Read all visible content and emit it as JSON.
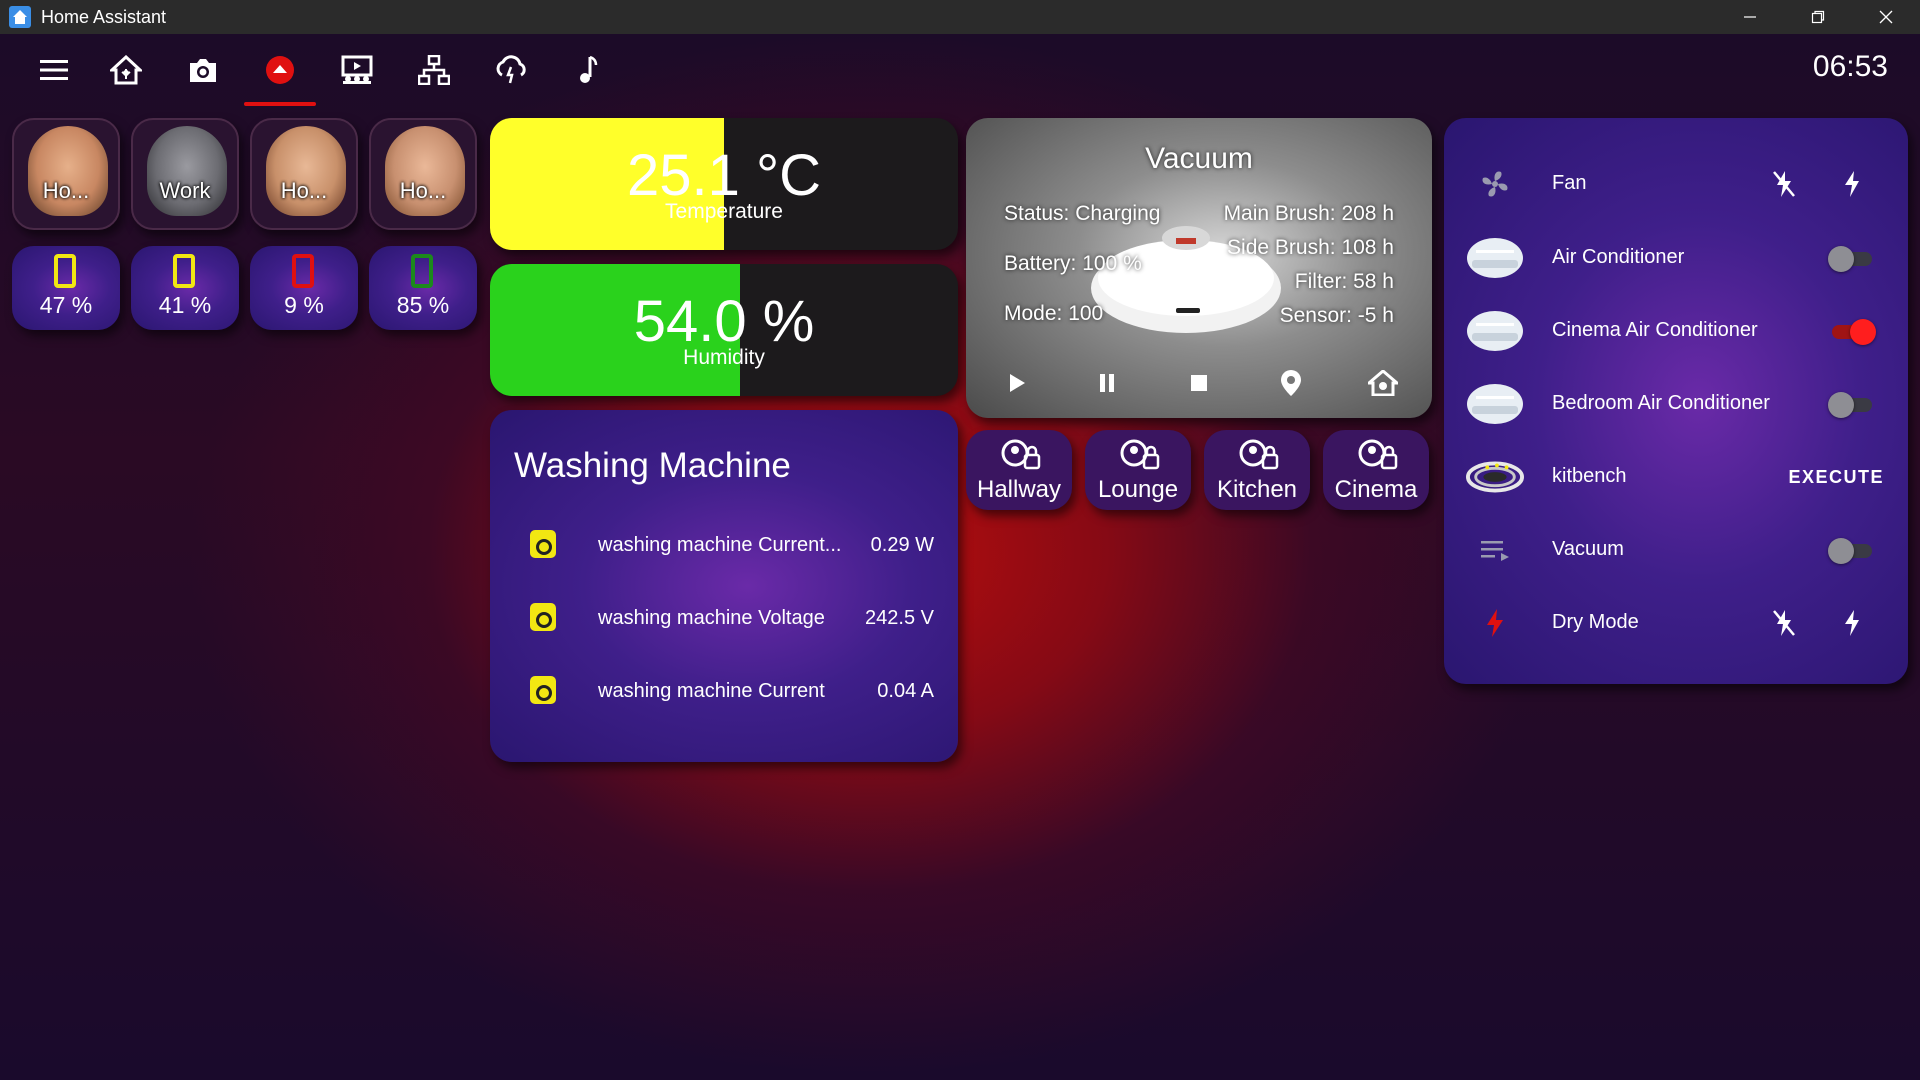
{
  "window": {
    "title": "Home Assistant"
  },
  "toolbar": {
    "clock": "06:53",
    "icons": [
      "menu-icon",
      "home-icon",
      "camera-icon",
      "alert-icon",
      "theater-icon",
      "network-icon",
      "cloud-icon",
      "music-icon"
    ],
    "active_index": 3,
    "accent_color": "#e01010"
  },
  "people": [
    {
      "name": "Ho...",
      "battery": "47 %",
      "battery_color": "#f2e712"
    },
    {
      "name": "Work",
      "battery": "41 %",
      "battery_color": "#f2e712"
    },
    {
      "name": "Ho...",
      "battery": "9 %",
      "battery_color": "#e01010"
    },
    {
      "name": "Ho...",
      "battery": "85 %",
      "battery_color": "#1c8a1c"
    }
  ],
  "temperature": {
    "value": "25.1 °C",
    "label": "Temperature",
    "fill_fraction": 0.5,
    "fill_color": "#ffff2a"
  },
  "humidity": {
    "value": "54.0 %",
    "label": "Humidity",
    "fill_fraction": 0.54,
    "fill_color": "#2ad21c"
  },
  "washing_machine": {
    "title": "Washing Machine",
    "rows": [
      {
        "name": "washing machine Current...",
        "value": "0.29 W"
      },
      {
        "name": "washing machine Voltage",
        "value": "242.5 V"
      },
      {
        "name": "washing machine Current",
        "value": "0.04 A"
      }
    ]
  },
  "vacuum": {
    "title": "Vacuum",
    "status": "Status: Charging",
    "battery": "Battery: 100 %",
    "mode": "Mode: 100",
    "main_brush": "Main Brush: 208 h",
    "side_brush": "Side Brush: 108 h",
    "filter": "Filter: 58 h",
    "sensor": "Sensor: -5 h",
    "buttons": [
      "play-icon",
      "pause-icon",
      "stop-icon",
      "locate-icon",
      "home-dock-icon"
    ]
  },
  "rooms": [
    "Hallway",
    "Lounge",
    "Kitchen",
    "Cinema"
  ],
  "entities": {
    "execute_label": "EXECUTE",
    "rows": [
      {
        "name": "Fan",
        "icon": "fan-icon",
        "control": "bolts"
      },
      {
        "name": "Air Conditioner",
        "icon": "air-conditioner-icon",
        "control": "toggle",
        "on": false
      },
      {
        "name": "Cinema Air Conditioner",
        "icon": "air-conditioner-icon",
        "control": "toggle",
        "on": true
      },
      {
        "name": "Bedroom Air Conditioner",
        "icon": "air-conditioner-icon",
        "control": "toggle",
        "on": false
      },
      {
        "name": "kitbench",
        "icon": "led-strip-icon",
        "control": "execute"
      },
      {
        "name": "Vacuum",
        "icon": "playlist-icon",
        "control": "toggle",
        "on": false
      },
      {
        "name": "Dry Mode",
        "icon": "lightning-icon",
        "control": "bolts"
      }
    ]
  }
}
